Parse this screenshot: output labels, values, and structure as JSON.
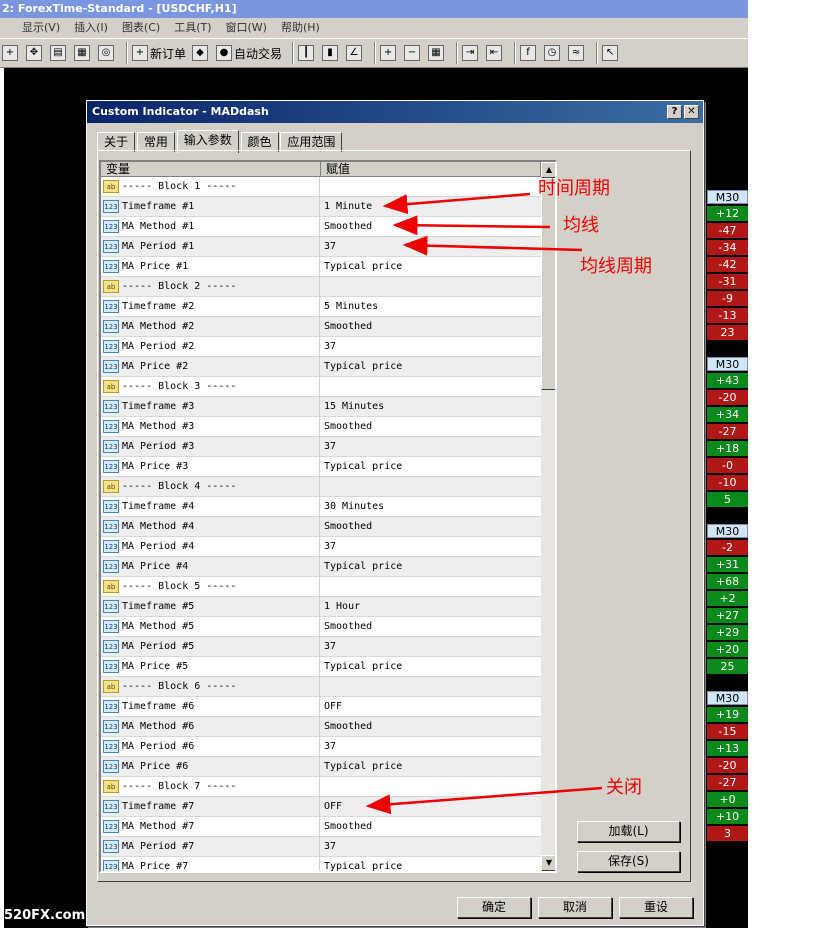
{
  "window": {
    "title": "2: ForexTime-Standard - [USDCHF,H1]"
  },
  "menu": [
    "显示(V)",
    "插入(I)",
    "图表(C)",
    "工具(T)",
    "窗口(W)",
    "帮助(H)"
  ],
  "toolbar": {
    "new_order": "新订单",
    "auto_trade": "自动交易"
  },
  "dialog": {
    "title": "Custom Indicator - MADdash",
    "help_btn": "?",
    "close_btn": "✕",
    "tabs": [
      "关于",
      "常用",
      "输入参数",
      "颜色",
      "应用范围"
    ],
    "grid_head": {
      "variable": "变量",
      "value": "赋值"
    },
    "rows": [
      {
        "icon": "ab",
        "name": "----- Block 1 -----",
        "value": ""
      },
      {
        "icon": "123",
        "name": "Timeframe #1",
        "value": "1 Minute"
      },
      {
        "icon": "123",
        "name": "MA Method #1",
        "value": "Smoothed"
      },
      {
        "icon": "123",
        "name": "MA Period #1",
        "value": "37"
      },
      {
        "icon": "123",
        "name": "MA Price #1",
        "value": "Typical price"
      },
      {
        "icon": "ab",
        "name": "----- Block 2 -----",
        "value": ""
      },
      {
        "icon": "123",
        "name": "Timeframe #2",
        "value": "5 Minutes"
      },
      {
        "icon": "123",
        "name": "MA Method #2",
        "value": "Smoothed"
      },
      {
        "icon": "123",
        "name": "MA Period #2",
        "value": "37"
      },
      {
        "icon": "123",
        "name": "MA Price #2",
        "value": "Typical price"
      },
      {
        "icon": "ab",
        "name": "----- Block 3 -----",
        "value": ""
      },
      {
        "icon": "123",
        "name": "Timeframe #3",
        "value": "15 Minutes"
      },
      {
        "icon": "123",
        "name": "MA Method #3",
        "value": "Smoothed"
      },
      {
        "icon": "123",
        "name": "MA Period #3",
        "value": "37"
      },
      {
        "icon": "123",
        "name": "MA Price #3",
        "value": "Typical price"
      },
      {
        "icon": "ab",
        "name": "----- Block 4 -----",
        "value": ""
      },
      {
        "icon": "123",
        "name": "Timeframe #4",
        "value": "30 Minutes"
      },
      {
        "icon": "123",
        "name": "MA Method #4",
        "value": "Smoothed"
      },
      {
        "icon": "123",
        "name": "MA Period #4",
        "value": "37"
      },
      {
        "icon": "123",
        "name": "MA Price #4",
        "value": "Typical price"
      },
      {
        "icon": "ab",
        "name": "----- Block 5 -----",
        "value": ""
      },
      {
        "icon": "123",
        "name": "Timeframe #5",
        "value": "1 Hour"
      },
      {
        "icon": "123",
        "name": "MA Method #5",
        "value": "Smoothed"
      },
      {
        "icon": "123",
        "name": "MA Period #5",
        "value": "37"
      },
      {
        "icon": "123",
        "name": "MA Price #5",
        "value": "Typical price"
      },
      {
        "icon": "ab",
        "name": "----- Block 6 -----",
        "value": ""
      },
      {
        "icon": "123",
        "name": "Timeframe #6",
        "value": "OFF"
      },
      {
        "icon": "123",
        "name": "MA Method #6",
        "value": "Smoothed"
      },
      {
        "icon": "123",
        "name": "MA Period #6",
        "value": "37"
      },
      {
        "icon": "123",
        "name": "MA Price #6",
        "value": "Typical price"
      },
      {
        "icon": "ab",
        "name": "----- Block 7 -----",
        "value": ""
      },
      {
        "icon": "123",
        "name": "Timeframe #7",
        "value": "OFF"
      },
      {
        "icon": "123",
        "name": "MA Method #7",
        "value": "Smoothed"
      },
      {
        "icon": "123",
        "name": "MA Period #7",
        "value": "37"
      },
      {
        "icon": "123",
        "name": "MA Price #7",
        "value": "Typical price"
      }
    ],
    "load_btn": "加载(L)",
    "save_btn": "保存(S)",
    "ok_btn": "确定",
    "cancel_btn": "取消",
    "reset_btn": "重设"
  },
  "annotations": {
    "timeframe": "时间周期",
    "ma_method": "均线",
    "ma_period": "均线周期",
    "off": "关闭"
  },
  "dashboard": [
    {
      "label": "M30",
      "values": [
        {
          "v": "+12",
          "c": "g"
        },
        {
          "v": "-47",
          "c": "r"
        },
        {
          "v": "-34",
          "c": "r"
        },
        {
          "v": "-42",
          "c": "r"
        },
        {
          "v": "-31",
          "c": "r"
        },
        {
          "v": "-9",
          "c": "r"
        },
        {
          "v": "-13",
          "c": "r"
        },
        {
          "v": "23",
          "c": "r"
        }
      ]
    },
    {
      "label": "M30",
      "values": [
        {
          "v": "+43",
          "c": "g"
        },
        {
          "v": "-20",
          "c": "r"
        },
        {
          "v": "+34",
          "c": "g"
        },
        {
          "v": "-27",
          "c": "r"
        },
        {
          "v": "+18",
          "c": "g"
        },
        {
          "v": "-0",
          "c": "r"
        },
        {
          "v": "-10",
          "c": "r"
        },
        {
          "v": "5",
          "c": "g"
        }
      ]
    },
    {
      "label": "M30",
      "values": [
        {
          "v": "-2",
          "c": "r"
        },
        {
          "v": "+31",
          "c": "g"
        },
        {
          "v": "+68",
          "c": "g"
        },
        {
          "v": "+2",
          "c": "g"
        },
        {
          "v": "+27",
          "c": "g"
        },
        {
          "v": "+29",
          "c": "g"
        },
        {
          "v": "+20",
          "c": "g"
        },
        {
          "v": "25",
          "c": "g"
        }
      ]
    },
    {
      "label": "M30",
      "values": [
        {
          "v": "+19",
          "c": "g"
        },
        {
          "v": "-15",
          "c": "r"
        },
        {
          "v": "+13",
          "c": "g"
        },
        {
          "v": "-20",
          "c": "r"
        },
        {
          "v": "-27",
          "c": "r"
        },
        {
          "v": "+0",
          "c": "g"
        },
        {
          "v": "+10",
          "c": "g"
        },
        {
          "v": "3",
          "c": "r"
        }
      ]
    }
  ],
  "watermark": "520FX.com"
}
